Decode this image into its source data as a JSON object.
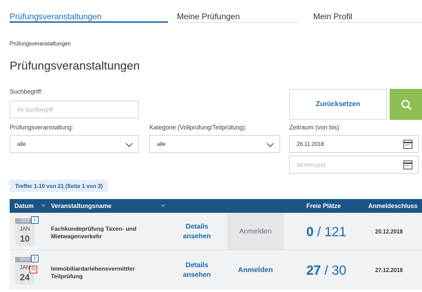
{
  "nav": {
    "tabs": [
      {
        "label": "Prüfungsveranstaltungen",
        "active": true
      },
      {
        "label": "Meine Prüfungen",
        "active": false
      },
      {
        "label": "Mein Profil",
        "active": false
      }
    ]
  },
  "breadcrumb": "Prüfungsveranstaltungen",
  "page_title": "Prüfungsveranstaltungen",
  "filters": {
    "search_label": "Suchbegriff:",
    "search_placeholder": "Ihr Suchbegriff",
    "reset_label": "Zurücksetzen",
    "event_label": "Prüfungsveranstaltung:",
    "event_value": "alle",
    "category_label": "Kategorie (Vollprüfung/Teilprüfung):",
    "category_value": "alle",
    "period_label": "Zeitraum (von bis):",
    "date_from": "26.11.2018",
    "date_to_placeholder": "dd.mm.yyyy"
  },
  "hits_text": "Treffer 1-10 von 21 (Seite 1 von 3)",
  "table": {
    "headers": {
      "date": "Datum",
      "name": "Veranstaltungsname",
      "seats": "Freie Plätze",
      "deadline": "Anmeldeschluss"
    },
    "rows": [
      {
        "year": "2019",
        "month": "JAN",
        "day": "10",
        "badge_count": "1",
        "new_badge": "",
        "name_line1": "Fachkundeprüfung Taxen- und",
        "name_line2": "Mietwagenverkehr",
        "details_line1": "Details",
        "details_line2": "ansehen",
        "register_label": "Anmelden",
        "register_enabled": false,
        "seats_free": "0",
        "seats_sep": " / ",
        "seats_total": "121",
        "deadline": "20.12.2018"
      },
      {
        "year": "2019",
        "month": "JAN",
        "day": "24",
        "badge_count": "1",
        "new_badge": "N",
        "name_line1": "Immobiliardarlehensvermittler",
        "name_line2": "Teilprüfung",
        "details_line1": "Details",
        "details_line2": "ansehen",
        "register_label": "Anmelden",
        "register_enabled": true,
        "seats_free": "27",
        "seats_sep": " / ",
        "seats_total": "30",
        "deadline": "27.12.2018"
      }
    ]
  },
  "colors": {
    "accent": "#1c6aa8",
    "header_bg": "#1c5584",
    "search_button": "#8dbf52",
    "new_badge": "#d0211c"
  }
}
